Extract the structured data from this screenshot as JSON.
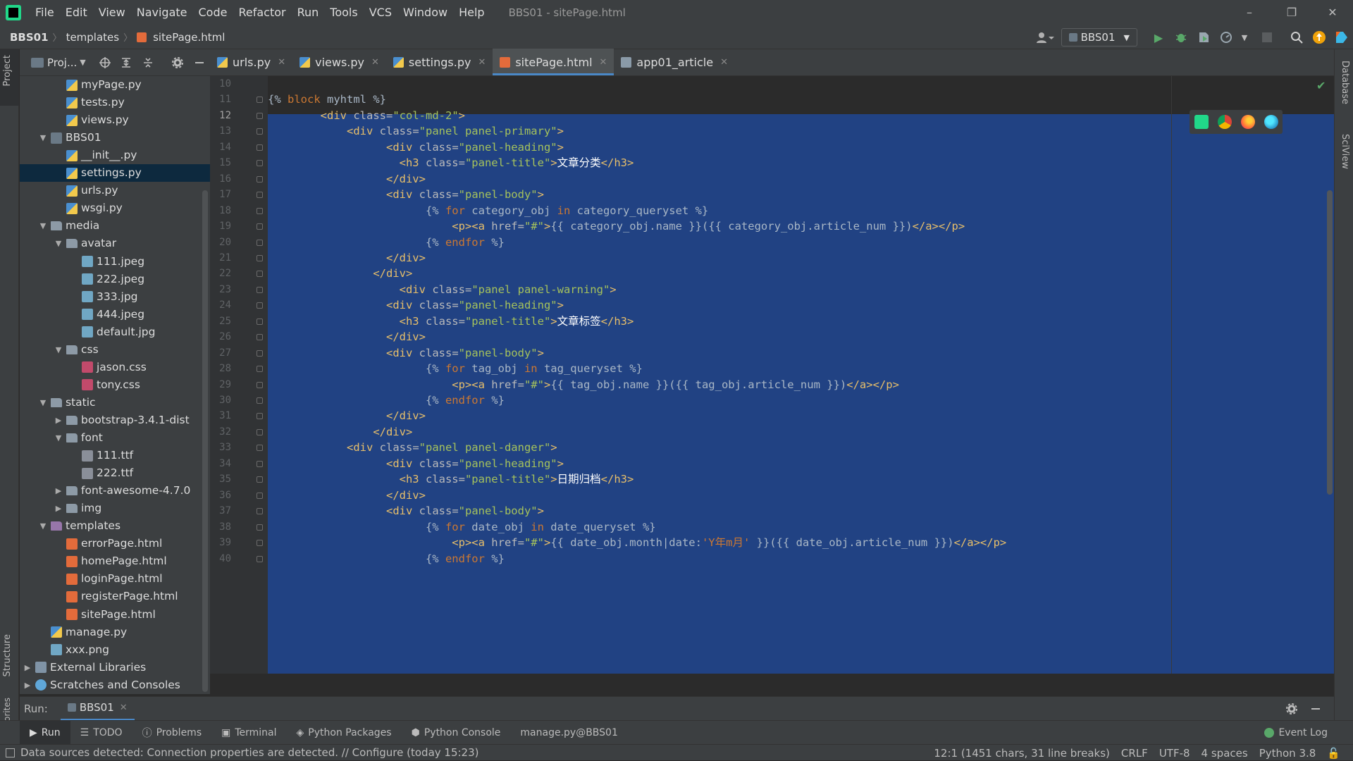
{
  "menu": {
    "items": [
      "File",
      "Edit",
      "View",
      "Navigate",
      "Code",
      "Refactor",
      "Run",
      "Tools",
      "VCS",
      "Window",
      "Help"
    ],
    "window_title": "BBS01 - sitePage.html"
  },
  "window_controls": {
    "minimize": "–",
    "restore": "❐",
    "close": "✕"
  },
  "breadcrumb": {
    "project": "BBS01",
    "folder": "templates",
    "file": "sitePage.html"
  },
  "toolbar": {
    "run_config": "BBS01"
  },
  "left_strip": {
    "project": "Project",
    "structure": "Structure",
    "favorites": "Favorites"
  },
  "right_strip": {
    "database": "Database",
    "sciview": "SciView"
  },
  "project_panel": {
    "title": "Proj...",
    "icon_names": [
      "project-view-icon",
      "locate-icon",
      "expand-all-icon",
      "collapse-all-icon",
      "gear-icon",
      "hide-icon"
    ]
  },
  "tree": [
    {
      "label": "myPage.py",
      "icon": "py",
      "depth": 3,
      "arrow": ""
    },
    {
      "label": "tests.py",
      "icon": "py",
      "depth": 3,
      "arrow": ""
    },
    {
      "label": "views.py",
      "icon": "py",
      "depth": 3,
      "arrow": ""
    },
    {
      "label": "BBS01",
      "icon": "proj",
      "depth": 2,
      "arrow": "v"
    },
    {
      "label": "__init__.py",
      "icon": "py",
      "depth": 3,
      "arrow": ""
    },
    {
      "label": "settings.py",
      "icon": "py",
      "depth": 3,
      "arrow": "",
      "selected": true
    },
    {
      "label": "urls.py",
      "icon": "py",
      "depth": 3,
      "arrow": ""
    },
    {
      "label": "wsgi.py",
      "icon": "py",
      "depth": 3,
      "arrow": ""
    },
    {
      "label": "media",
      "icon": "folder",
      "depth": 2,
      "arrow": "v"
    },
    {
      "label": "avatar",
      "icon": "folder",
      "depth": 3,
      "arrow": "v"
    },
    {
      "label": "111.jpeg",
      "icon": "img",
      "depth": 4,
      "arrow": ""
    },
    {
      "label": "222.jpeg",
      "icon": "img",
      "depth": 4,
      "arrow": ""
    },
    {
      "label": "333.jpg",
      "icon": "img",
      "depth": 4,
      "arrow": ""
    },
    {
      "label": "444.jpeg",
      "icon": "img",
      "depth": 4,
      "arrow": ""
    },
    {
      "label": "default.jpg",
      "icon": "img",
      "depth": 4,
      "arrow": ""
    },
    {
      "label": "css",
      "icon": "folder",
      "depth": 3,
      "arrow": "v"
    },
    {
      "label": "jason.css",
      "icon": "css",
      "depth": 4,
      "arrow": ""
    },
    {
      "label": "tony.css",
      "icon": "css",
      "depth": 4,
      "arrow": ""
    },
    {
      "label": "static",
      "icon": "folder",
      "depth": 2,
      "arrow": "v"
    },
    {
      "label": "bootstrap-3.4.1-dist",
      "icon": "folder",
      "depth": 3,
      "arrow": ">"
    },
    {
      "label": "font",
      "icon": "folder",
      "depth": 3,
      "arrow": "v"
    },
    {
      "label": "111.ttf",
      "icon": "ttf",
      "depth": 4,
      "arrow": ""
    },
    {
      "label": "222.ttf",
      "icon": "ttf",
      "depth": 4,
      "arrow": ""
    },
    {
      "label": "font-awesome-4.7.0",
      "icon": "folder",
      "depth": 3,
      "arrow": ">"
    },
    {
      "label": "img",
      "icon": "folder",
      "depth": 3,
      "arrow": ">"
    },
    {
      "label": "templates",
      "icon": "folder tpl",
      "depth": 2,
      "arrow": "v"
    },
    {
      "label": "errorPage.html",
      "icon": "html",
      "depth": 3,
      "arrow": ""
    },
    {
      "label": "homePage.html",
      "icon": "html",
      "depth": 3,
      "arrow": ""
    },
    {
      "label": "loginPage.html",
      "icon": "html",
      "depth": 3,
      "arrow": ""
    },
    {
      "label": "registerPage.html",
      "icon": "html",
      "depth": 3,
      "arrow": ""
    },
    {
      "label": "sitePage.html",
      "icon": "html",
      "depth": 3,
      "arrow": ""
    },
    {
      "label": "manage.py",
      "icon": "py",
      "depth": 2,
      "arrow": ""
    },
    {
      "label": "xxx.png",
      "icon": "img",
      "depth": 2,
      "arrow": ""
    },
    {
      "label": "External Libraries",
      "icon": "lib",
      "depth": 1,
      "arrow": ">"
    },
    {
      "label": "Scratches and Consoles",
      "icon": "scratch",
      "depth": 1,
      "arrow": ">"
    }
  ],
  "tabs": [
    {
      "label": "urls.py",
      "icon": "py"
    },
    {
      "label": "views.py",
      "icon": "py"
    },
    {
      "label": "settings.py",
      "icon": "py"
    },
    {
      "label": "sitePage.html",
      "icon": "html",
      "active": true
    },
    {
      "label": "app01_article",
      "icon": "table"
    }
  ],
  "editor": {
    "line_numbers": [
      "10",
      "11",
      "12",
      "13",
      "14",
      "15",
      "16",
      "17",
      "18",
      "19",
      "20",
      "21",
      "22",
      "23",
      "24",
      "25",
      "26",
      "27",
      "28",
      "29",
      "30",
      "31",
      "32",
      "33",
      "34",
      "35",
      "36",
      "37",
      "38",
      "39",
      "40"
    ],
    "lines": [
      [],
      [
        {
          "c": "tp",
          "t": "{% "
        },
        {
          "c": "kw",
          "t": "block "
        },
        {
          "c": "tp",
          "t": "myhtml %}"
        }
      ],
      [
        {
          "c": "tp",
          "t": "        "
        },
        {
          "c": "tg",
          "t": "<div "
        },
        {
          "c": "at",
          "t": "class="
        },
        {
          "c": "st",
          "t": "\"col-md-2\""
        },
        {
          "c": "tg",
          "t": ">"
        }
      ],
      [
        {
          "c": "tp",
          "t": "            "
        },
        {
          "c": "tg",
          "t": "<div "
        },
        {
          "c": "at",
          "t": "class="
        },
        {
          "c": "st",
          "t": "\"panel panel-primary\""
        },
        {
          "c": "tg",
          "t": ">"
        }
      ],
      [
        {
          "c": "tp",
          "t": "                  "
        },
        {
          "c": "tg",
          "t": "<div "
        },
        {
          "c": "at",
          "t": "class="
        },
        {
          "c": "st",
          "t": "\"panel-heading\""
        },
        {
          "c": "tg",
          "t": ">"
        }
      ],
      [
        {
          "c": "tp",
          "t": "                    "
        },
        {
          "c": "tg",
          "t": "<h3 "
        },
        {
          "c": "at",
          "t": "class="
        },
        {
          "c": "st",
          "t": "\"panel-title\""
        },
        {
          "c": "tg",
          "t": ">"
        },
        {
          "c": "tx",
          "t": "文章分类"
        },
        {
          "c": "tg",
          "t": "</h3>"
        }
      ],
      [
        {
          "c": "tp",
          "t": "                  "
        },
        {
          "c": "tg",
          "t": "</div>"
        }
      ],
      [
        {
          "c": "tp",
          "t": "                  "
        },
        {
          "c": "tg",
          "t": "<div "
        },
        {
          "c": "at",
          "t": "class="
        },
        {
          "c": "st",
          "t": "\"panel-body\""
        },
        {
          "c": "tg",
          "t": ">"
        }
      ],
      [
        {
          "c": "tp",
          "t": "                        {% "
        },
        {
          "c": "kw",
          "t": "for "
        },
        {
          "c": "tp",
          "t": "category_obj "
        },
        {
          "c": "kw",
          "t": "in "
        },
        {
          "c": "tp",
          "t": "category_queryset %}"
        }
      ],
      [
        {
          "c": "tp",
          "t": "                            "
        },
        {
          "c": "tg",
          "t": "<p><a "
        },
        {
          "c": "at",
          "t": "href="
        },
        {
          "c": "st",
          "t": "\"#\""
        },
        {
          "c": "tg",
          "t": ">"
        },
        {
          "c": "tp",
          "t": "{{ category_obj.name }}({{ category_obj.article_num }})"
        },
        {
          "c": "tg",
          "t": "</a></p>"
        }
      ],
      [
        {
          "c": "tp",
          "t": "                        {% "
        },
        {
          "c": "kw",
          "t": "endfor "
        },
        {
          "c": "tp",
          "t": "%}"
        }
      ],
      [
        {
          "c": "tp",
          "t": "                  "
        },
        {
          "c": "tg",
          "t": "</div>"
        }
      ],
      [
        {
          "c": "tp",
          "t": "                "
        },
        {
          "c": "tg",
          "t": "</div>"
        }
      ],
      [
        {
          "c": "tp",
          "t": "                    "
        },
        {
          "c": "tg",
          "t": "<div "
        },
        {
          "c": "at",
          "t": "class="
        },
        {
          "c": "st",
          "t": "\"panel panel-warning\""
        },
        {
          "c": "tg",
          "t": ">"
        }
      ],
      [
        {
          "c": "tp",
          "t": "                  "
        },
        {
          "c": "tg",
          "t": "<div "
        },
        {
          "c": "at",
          "t": "class="
        },
        {
          "c": "st",
          "t": "\"panel-heading\""
        },
        {
          "c": "tg",
          "t": ">"
        }
      ],
      [
        {
          "c": "tp",
          "t": "                    "
        },
        {
          "c": "tg",
          "t": "<h3 "
        },
        {
          "c": "at",
          "t": "class="
        },
        {
          "c": "st",
          "t": "\"panel-title\""
        },
        {
          "c": "tg",
          "t": ">"
        },
        {
          "c": "tx",
          "t": "文章标签"
        },
        {
          "c": "tg",
          "t": "</h3>"
        }
      ],
      [
        {
          "c": "tp",
          "t": "                  "
        },
        {
          "c": "tg",
          "t": "</div>"
        }
      ],
      [
        {
          "c": "tp",
          "t": "                  "
        },
        {
          "c": "tg",
          "t": "<div "
        },
        {
          "c": "at",
          "t": "class="
        },
        {
          "c": "st",
          "t": "\"panel-body\""
        },
        {
          "c": "tg",
          "t": ">"
        }
      ],
      [
        {
          "c": "tp",
          "t": "                        {% "
        },
        {
          "c": "kw",
          "t": "for "
        },
        {
          "c": "tp",
          "t": "tag_obj "
        },
        {
          "c": "kw",
          "t": "in "
        },
        {
          "c": "tp",
          "t": "tag_queryset %}"
        }
      ],
      [
        {
          "c": "tp",
          "t": "                            "
        },
        {
          "c": "tg",
          "t": "<p><a "
        },
        {
          "c": "at",
          "t": "href="
        },
        {
          "c": "st",
          "t": "\"#\""
        },
        {
          "c": "tg",
          "t": ">"
        },
        {
          "c": "tp",
          "t": "{{ tag_obj.name }}({{ tag_obj.article_num }})"
        },
        {
          "c": "tg",
          "t": "</a></p>"
        }
      ],
      [
        {
          "c": "tp",
          "t": "                        {% "
        },
        {
          "c": "kw",
          "t": "endfor "
        },
        {
          "c": "tp",
          "t": "%}"
        }
      ],
      [
        {
          "c": "tp",
          "t": "                  "
        },
        {
          "c": "tg",
          "t": "</div>"
        }
      ],
      [
        {
          "c": "tp",
          "t": "                "
        },
        {
          "c": "tg",
          "t": "</div>"
        }
      ],
      [
        {
          "c": "tp",
          "t": "            "
        },
        {
          "c": "tg",
          "t": "<div "
        },
        {
          "c": "at",
          "t": "class="
        },
        {
          "c": "st",
          "t": "\"panel panel-danger\""
        },
        {
          "c": "tg",
          "t": ">"
        }
      ],
      [
        {
          "c": "tp",
          "t": "                  "
        },
        {
          "c": "tg",
          "t": "<div "
        },
        {
          "c": "at",
          "t": "class="
        },
        {
          "c": "st",
          "t": "\"panel-heading\""
        },
        {
          "c": "tg",
          "t": ">"
        }
      ],
      [
        {
          "c": "tp",
          "t": "                    "
        },
        {
          "c": "tg",
          "t": "<h3 "
        },
        {
          "c": "at",
          "t": "class="
        },
        {
          "c": "st",
          "t": "\"panel-title\""
        },
        {
          "c": "tg",
          "t": ">"
        },
        {
          "c": "tx",
          "t": "日期归档"
        },
        {
          "c": "tg",
          "t": "</h3>"
        }
      ],
      [
        {
          "c": "tp",
          "t": "                  "
        },
        {
          "c": "tg",
          "t": "</div>"
        }
      ],
      [
        {
          "c": "tp",
          "t": "                  "
        },
        {
          "c": "tg",
          "t": "<div "
        },
        {
          "c": "at",
          "t": "class="
        },
        {
          "c": "st",
          "t": "\"panel-body\""
        },
        {
          "c": "tg",
          "t": ">"
        }
      ],
      [
        {
          "c": "tp",
          "t": "                        {% "
        },
        {
          "c": "kw",
          "t": "for "
        },
        {
          "c": "tp",
          "t": "date_obj "
        },
        {
          "c": "kw",
          "t": "in "
        },
        {
          "c": "tp",
          "t": "date_queryset %}"
        }
      ],
      [
        {
          "c": "tp",
          "t": "                            "
        },
        {
          "c": "tg",
          "t": "<p><a "
        },
        {
          "c": "at",
          "t": "href="
        },
        {
          "c": "st",
          "t": "\"#\""
        },
        {
          "c": "tg",
          "t": ">"
        },
        {
          "c": "tp",
          "t": "{{ date_obj.month|date:"
        },
        {
          "c": "orange",
          "t": "'Y年m月'"
        },
        {
          "c": "tp",
          "t": " }}({{ date_obj.article_num }})"
        },
        {
          "c": "tg",
          "t": "</a></p>"
        }
      ],
      [
        {
          "c": "tp",
          "t": "                        {% "
        },
        {
          "c": "kw",
          "t": "endfor "
        },
        {
          "c": "tp",
          "t": "%}"
        }
      ]
    ]
  },
  "run_panel": {
    "label": "Run:",
    "tab": "BBS01"
  },
  "bottom_tabs": [
    {
      "label": "Run",
      "icon": "play-icon",
      "active": true
    },
    {
      "label": "TODO",
      "icon": "list-icon"
    },
    {
      "label": "Problems",
      "icon": "info-icon"
    },
    {
      "label": "Terminal",
      "icon": "terminal-icon"
    },
    {
      "label": "Python Packages",
      "icon": "packages-icon"
    },
    {
      "label": "Python Console",
      "icon": "python-console-icon"
    },
    {
      "label": "manage.py@BBS01",
      "icon": ""
    }
  ],
  "event_log": "Event Log",
  "status": {
    "message": "Data sources detected: Connection properties are detected. // Configure (today 15:23)",
    "position": "12:1 (1451 chars, 31 line breaks)",
    "line_sep": "CRLF",
    "encoding": "UTF-8",
    "indent": "4 spaces",
    "interpreter": "Python 3.8"
  },
  "colors": {
    "accent": "#4a88c7",
    "selection": "#214283",
    "background": "#2b2b2b",
    "panel": "#3c3f41"
  }
}
